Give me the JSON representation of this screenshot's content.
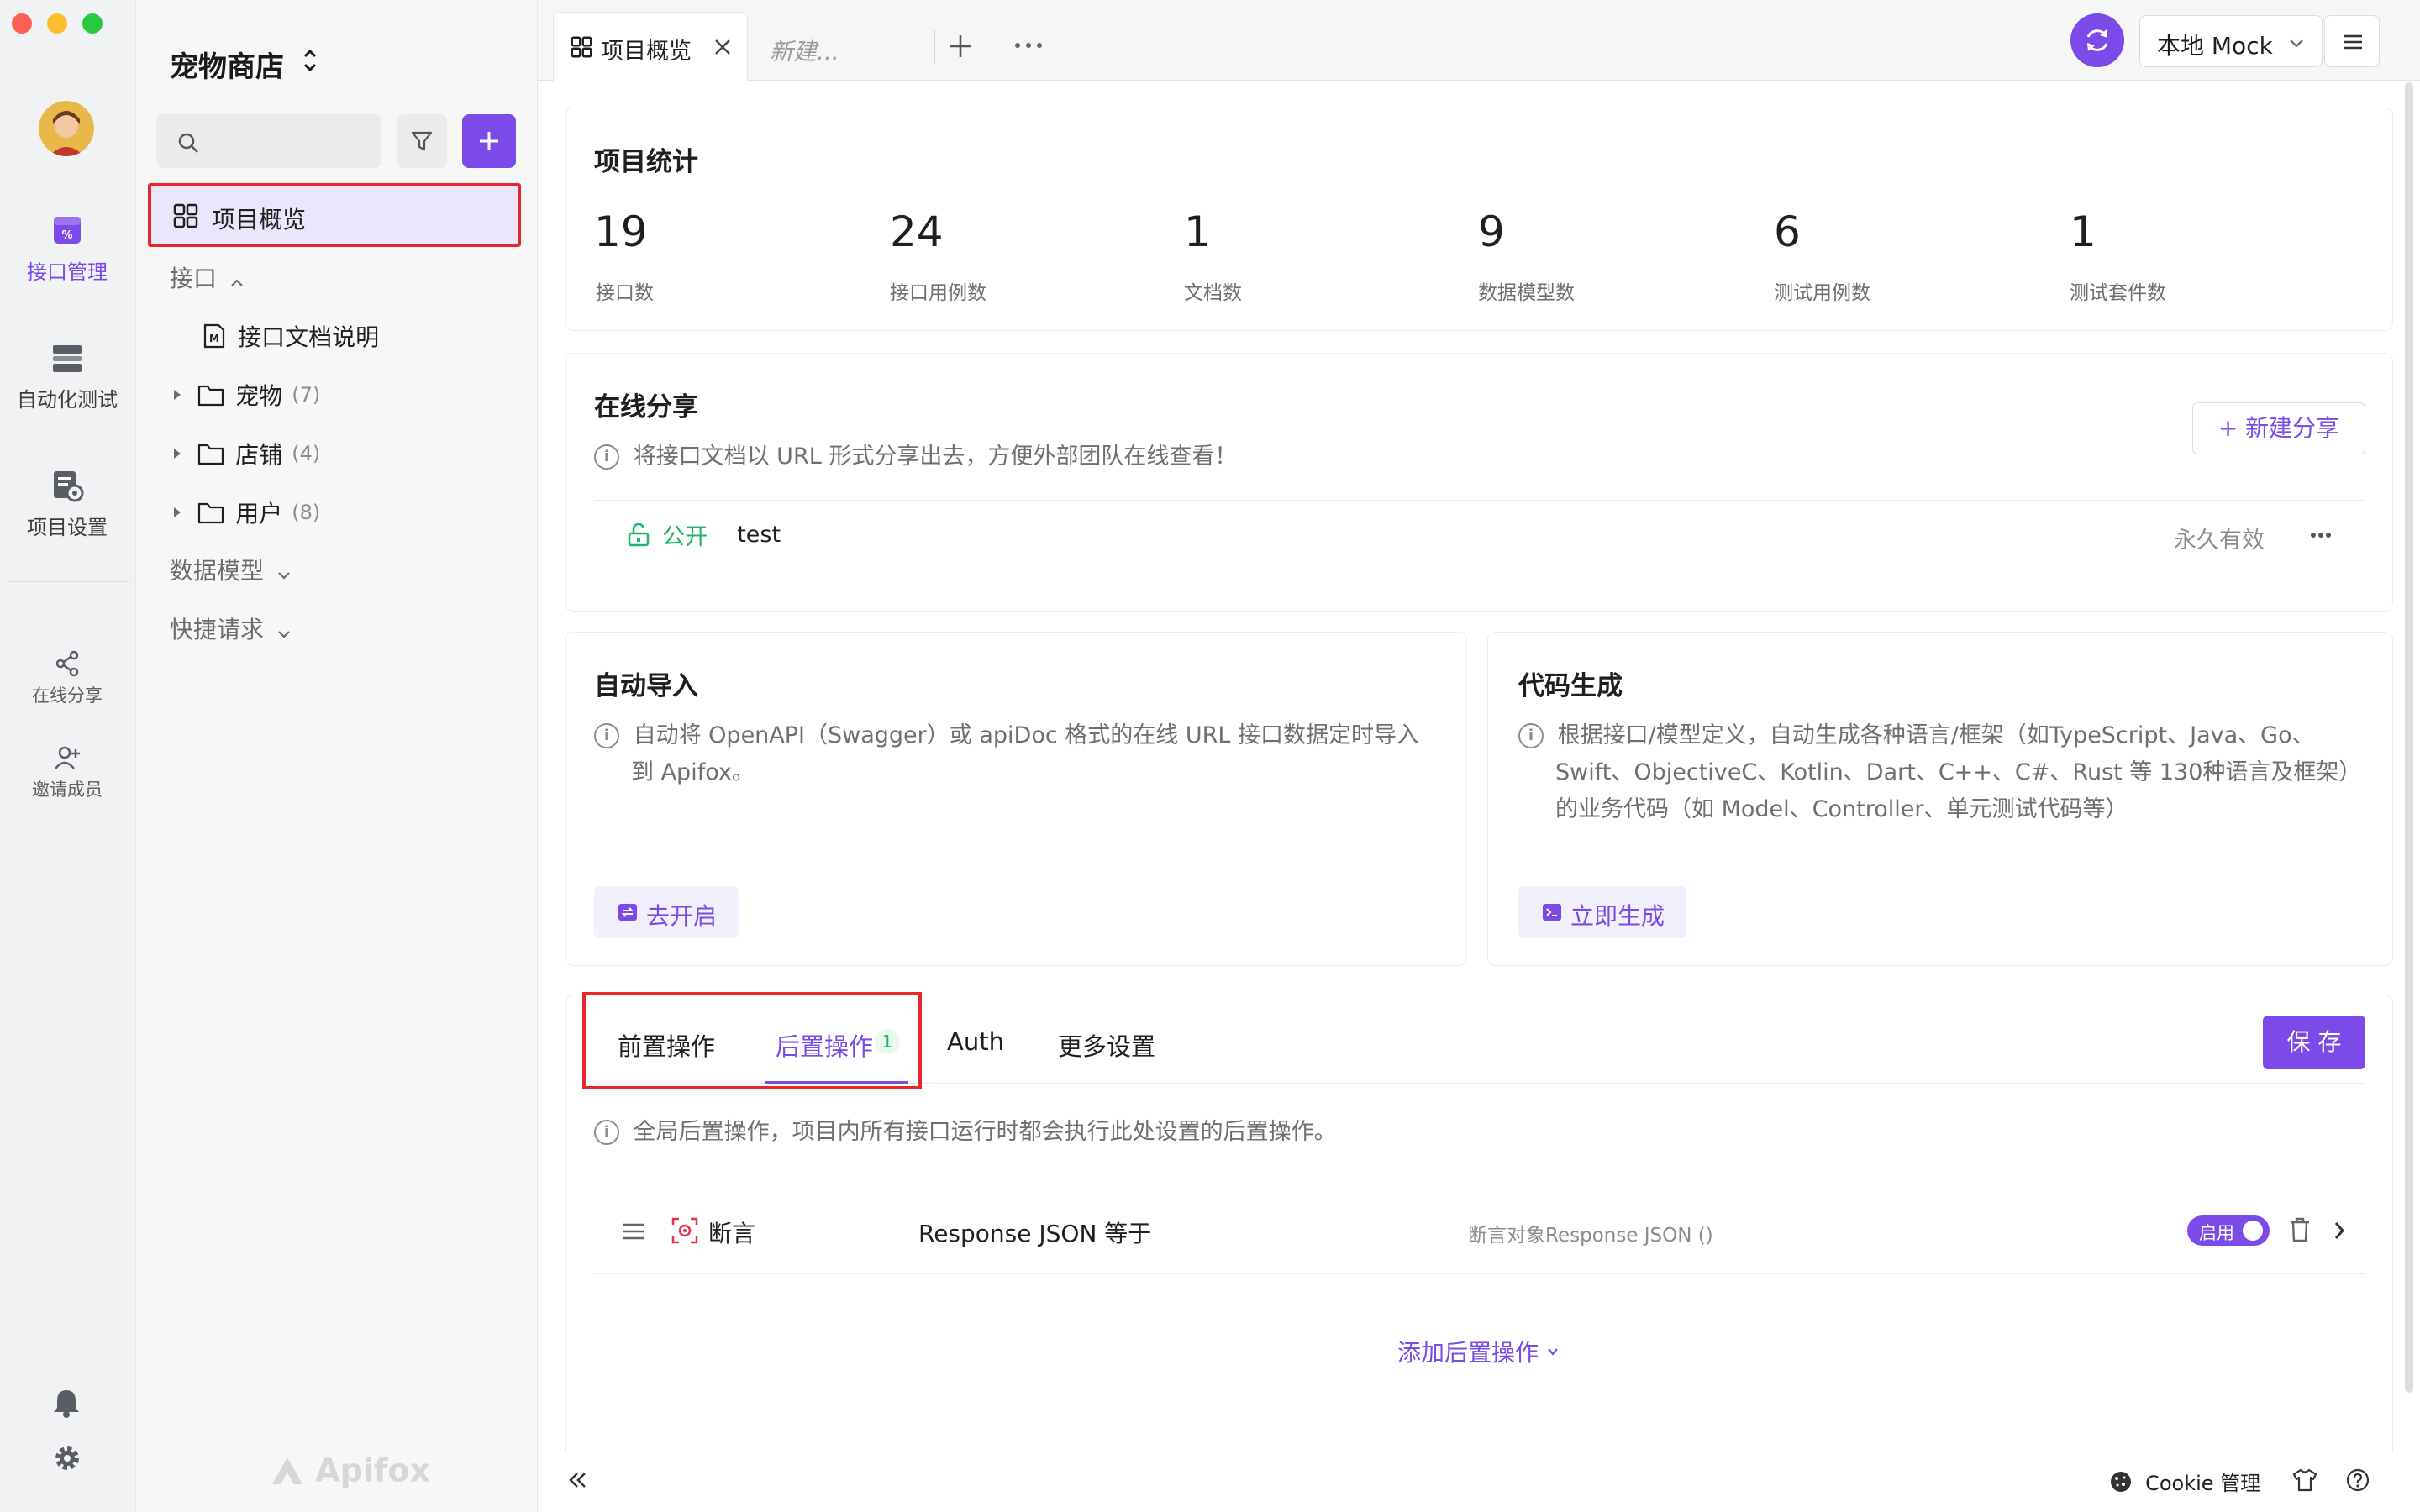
{
  "project": {
    "name": "宠物商店"
  },
  "rail": {
    "items": [
      {
        "label": "接口管理",
        "active": true
      },
      {
        "label": "自动化测试"
      },
      {
        "label": "项目设置"
      }
    ],
    "small_items": [
      {
        "label": "在线分享"
      },
      {
        "label": "邀请成员"
      }
    ]
  },
  "sidebar": {
    "search_placeholder": "",
    "overview_label": "项目概览",
    "api_group": "接口",
    "doc_item": "接口文档说明",
    "folders": [
      {
        "name": "宠物",
        "count": "(7)"
      },
      {
        "name": "店铺",
        "count": "(4)"
      },
      {
        "name": "用户",
        "count": "(8)"
      }
    ],
    "data_models": "数据模型",
    "quick_request": "快捷请求",
    "watermark": "Apifox"
  },
  "tabs": {
    "active": "项目概览",
    "new": "新建..."
  },
  "env": {
    "label": "本地 Mock"
  },
  "stats": {
    "title": "项目统计",
    "items": [
      {
        "value": "19",
        "label": "接口数"
      },
      {
        "value": "24",
        "label": "接口用例数"
      },
      {
        "value": "1",
        "label": "文档数"
      },
      {
        "value": "9",
        "label": "数据模型数"
      },
      {
        "value": "6",
        "label": "测试用例数"
      },
      {
        "value": "1",
        "label": "测试套件数"
      }
    ]
  },
  "share": {
    "title": "在线分享",
    "desc": "将接口文档以 URL 形式分享出去，方便外部团队在线查看！",
    "new_button": "+ 新建分享",
    "row": {
      "visibility": "公开",
      "name": "test",
      "expiry": "永久有效"
    }
  },
  "import": {
    "title": "自动导入",
    "desc_line1": "自动将 OpenAPI（Swagger）或 apiDoc 格式的在线 URL 接口数据定时导入",
    "desc_line2": "到 Apifox。",
    "button": "去开启"
  },
  "codegen": {
    "title": "代码生成",
    "desc_line1": "根据接口/模型定义，自动生成各种语言/框架（如TypeScript、Java、Go、",
    "desc_line2": "Swift、ObjectiveC、Kotlin、Dart、C++、C#、Rust 等 130种语言及框架）",
    "desc_line3": "的业务代码（如 Model、Controller、单元测试代码等）",
    "button": "立即生成"
  },
  "ops": {
    "tabs": [
      {
        "label": "前置操作"
      },
      {
        "label": "后置操作",
        "badge": "1",
        "active": true
      },
      {
        "label": "Auth"
      },
      {
        "label": "更多设置"
      }
    ],
    "save": "保 存",
    "desc": "全局后置操作，项目内所有接口运行时都会执行此处设置的后置操作。",
    "row": {
      "type": "断言",
      "name": "Response JSON 等于",
      "detail": "断言对象Response JSON ()",
      "toggle": "启用"
    },
    "add": "添加后置操作"
  },
  "status": {
    "cookie": "Cookie 管理"
  },
  "colors": {
    "accent": "#7b4ae8",
    "highlight": "#e8262c",
    "public": "#1db56b"
  }
}
